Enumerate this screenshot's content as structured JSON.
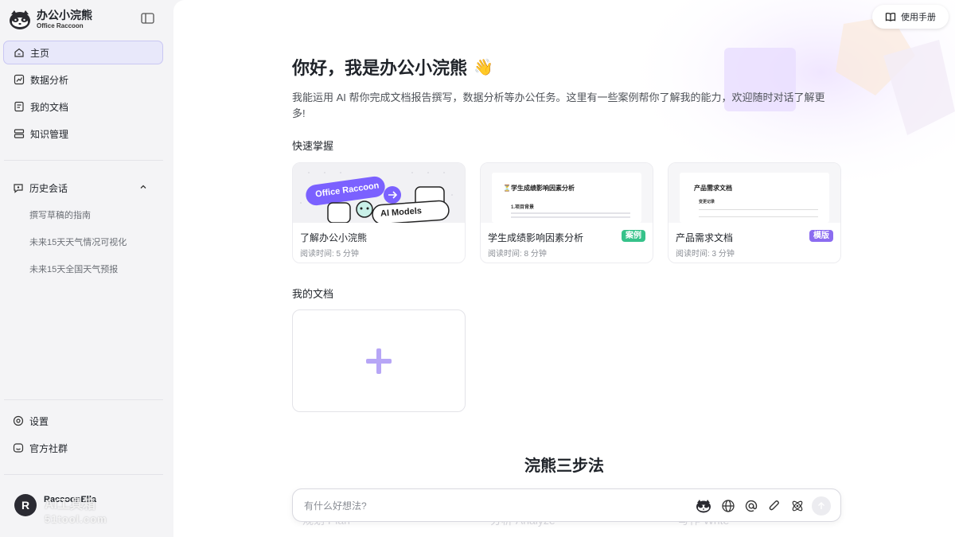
{
  "brand": {
    "name": "办公小浣熊",
    "subtitle": "Office Raccoon"
  },
  "nav": [
    {
      "label": "主页",
      "icon": "home-icon",
      "active": true
    },
    {
      "label": "数据分析",
      "icon": "chart-icon"
    },
    {
      "label": "我的文档",
      "icon": "document-icon"
    },
    {
      "label": "知识管理",
      "icon": "database-icon"
    }
  ],
  "history": {
    "title": "历史会话",
    "items": [
      "撰写草稿的指南",
      "未来15天天气情况可视化",
      "未来15天全国天气预报"
    ]
  },
  "bottom_nav": {
    "settings": "设置",
    "community": "官方社群"
  },
  "user": {
    "initial": "R",
    "name": "RaccoonElla"
  },
  "watermark": {
    "line1": "AI工具箱",
    "line2": "51tool.com"
  },
  "header": {
    "manual_label": "使用手册"
  },
  "greeting": {
    "title": "你好，我是办公小浣熊",
    "emoji": "👋",
    "intro": "我能运用 AI 帮你完成文档报告撰写，数据分析等办公任务。这里有一些案例帮你了解我的能力，欢迎随时对话了解更多!"
  },
  "quick": {
    "title": "快速掌握",
    "cards": [
      {
        "title": "了解办公小浣熊",
        "meta": "阅读时间: 5 分钟",
        "thumb_tag1": "Office Raccoon",
        "thumb_tag2": "AI Models"
      },
      {
        "title": "学生成绩影响因素分析",
        "meta": "阅读时间: 8 分钟",
        "badge": "案例",
        "badge_color": "#36c28a",
        "thumb_heading": "⏳学生成绩影响因素分析",
        "thumb_sub": "1.项目背景"
      },
      {
        "title": "产品需求文档",
        "meta": "阅读时间: 3 分钟",
        "badge": "模版",
        "badge_color": "#8b6cf0",
        "thumb_heading": "产品需求文档",
        "thumb_sub": "变更记录"
      }
    ]
  },
  "docs": {
    "title": "我的文档"
  },
  "steps": {
    "title": "浣熊三步法",
    "faded": [
      "规划 Plan",
      "分析 Analyze",
      "写作 Write"
    ]
  },
  "input": {
    "placeholder": "有什么好想法?"
  },
  "colors": {
    "accent": "#7b61ff",
    "accent_light": "#b7a6f6"
  }
}
